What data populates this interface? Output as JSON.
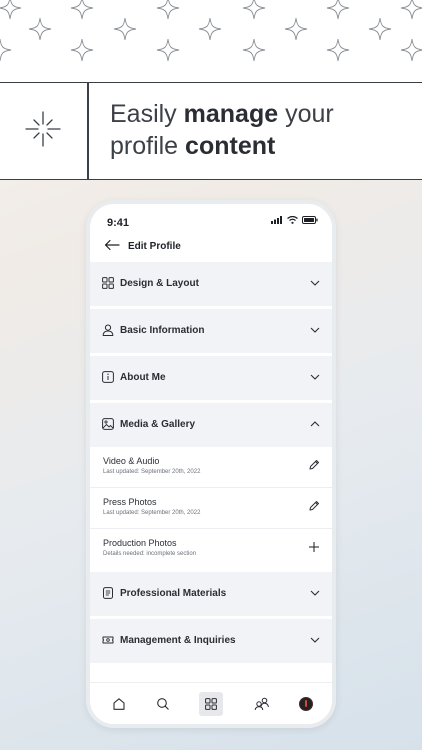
{
  "headline": {
    "line1_regular": "Easily ",
    "line1_bold": "manage",
    "line1_tail": " your",
    "line2_regular": "profile ",
    "line2_bold": "content"
  },
  "status_bar": {
    "time": "9:41"
  },
  "app_bar": {
    "title": "Edit Profile"
  },
  "sections": [
    {
      "label": "Design & Layout",
      "icon": "grid-icon",
      "state": "collapsed"
    },
    {
      "label": "Basic Information",
      "icon": "person-icon",
      "state": "collapsed"
    },
    {
      "label": "About Me",
      "icon": "info-icon",
      "state": "collapsed"
    },
    {
      "label": "Media & Gallery",
      "icon": "image-icon",
      "state": "expanded"
    },
    {
      "label": "Professional Materials",
      "icon": "document-icon",
      "state": "collapsed"
    },
    {
      "label": "Management & Inquiries",
      "icon": "ticket-icon",
      "state": "collapsed"
    }
  ],
  "media_items": [
    {
      "title": "Video & Audio",
      "subtitle": "Last updated: September 20th, 2022",
      "action": "pencil-icon"
    },
    {
      "title": "Press Photos",
      "subtitle": "Last updated: September 20th, 2022",
      "action": "pencil-icon"
    },
    {
      "title": "Production Photos",
      "subtitle": "Details needed: incomplete section",
      "action": "plus-icon"
    }
  ],
  "tabbar": [
    "home-icon",
    "search-icon",
    "grid-icon",
    "people-icon",
    "avatar"
  ],
  "colors": {
    "section_bg": "#f1f3f6",
    "text": "#2a2d33",
    "border": "#3b3f46"
  }
}
